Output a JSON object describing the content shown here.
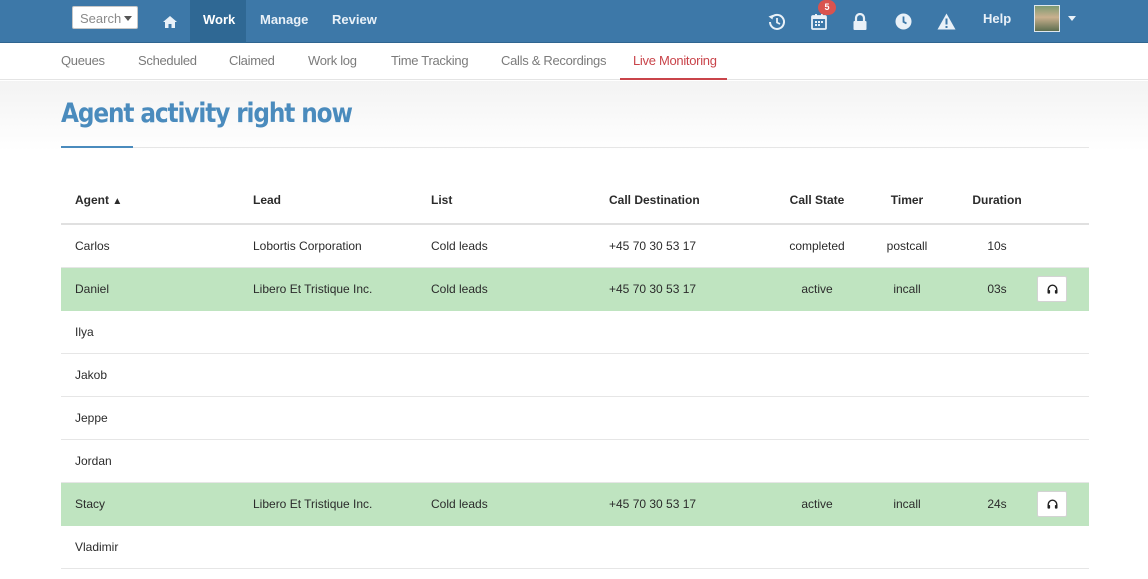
{
  "topbar": {
    "search_placeholder": "Search",
    "nav": [
      {
        "label": "Work",
        "active": true
      },
      {
        "label": "Manage",
        "active": false
      },
      {
        "label": "Review",
        "active": false
      }
    ],
    "icons": [
      "home-icon",
      "history-icon",
      "calendar-icon",
      "lock-icon",
      "clock-icon",
      "warning-icon"
    ],
    "calendar_badge": "5",
    "help_label": "Help"
  },
  "subnav": {
    "items": [
      "Queues",
      "Scheduled",
      "Claimed",
      "Work log",
      "Time Tracking",
      "Calls & Recordings",
      "Live Monitoring"
    ],
    "active": "Live Monitoring"
  },
  "page": {
    "title": "Agent activity right now"
  },
  "table": {
    "headers": {
      "agent": "Agent",
      "agent_sort": "▲",
      "lead": "Lead",
      "list": "List",
      "destination": "Call Destination",
      "state": "Call State",
      "timer": "Timer",
      "duration": "Duration"
    },
    "rows": [
      {
        "agent": "Carlos",
        "lead": "Lobortis Corporation",
        "list": "Cold leads",
        "destination": "+45 70 30 53 17",
        "state": "completed",
        "timer": "postcall",
        "duration": "10s",
        "active": false
      },
      {
        "agent": "Daniel",
        "lead": "Libero Et Tristique Inc.",
        "list": "Cold leads",
        "destination": "+45 70 30 53 17",
        "state": "active",
        "timer": "incall",
        "duration": "03s",
        "active": true
      },
      {
        "agent": "Ilya",
        "lead": "",
        "list": "",
        "destination": "",
        "state": "",
        "timer": "",
        "duration": "",
        "active": false
      },
      {
        "agent": "Jakob",
        "lead": "",
        "list": "",
        "destination": "",
        "state": "",
        "timer": "",
        "duration": "",
        "active": false
      },
      {
        "agent": "Jeppe",
        "lead": "",
        "list": "",
        "destination": "",
        "state": "",
        "timer": "",
        "duration": "",
        "active": false
      },
      {
        "agent": "Jordan",
        "lead": "",
        "list": "",
        "destination": "",
        "state": "",
        "timer": "",
        "duration": "",
        "active": false
      },
      {
        "agent": "Stacy",
        "lead": "Libero Et Tristique Inc.",
        "list": "Cold leads",
        "destination": "+45 70 30 53 17",
        "state": "active",
        "timer": "incall",
        "duration": "24s",
        "active": true
      },
      {
        "agent": "Vladimir",
        "lead": "",
        "list": "",
        "destination": "",
        "state": "",
        "timer": "",
        "duration": "",
        "active": false
      }
    ]
  },
  "colors": {
    "topbar": "#3d78a8",
    "active_row": "#bfe4c0",
    "accent_red": "#c9444a",
    "title_blue": "#4a8bbd"
  }
}
